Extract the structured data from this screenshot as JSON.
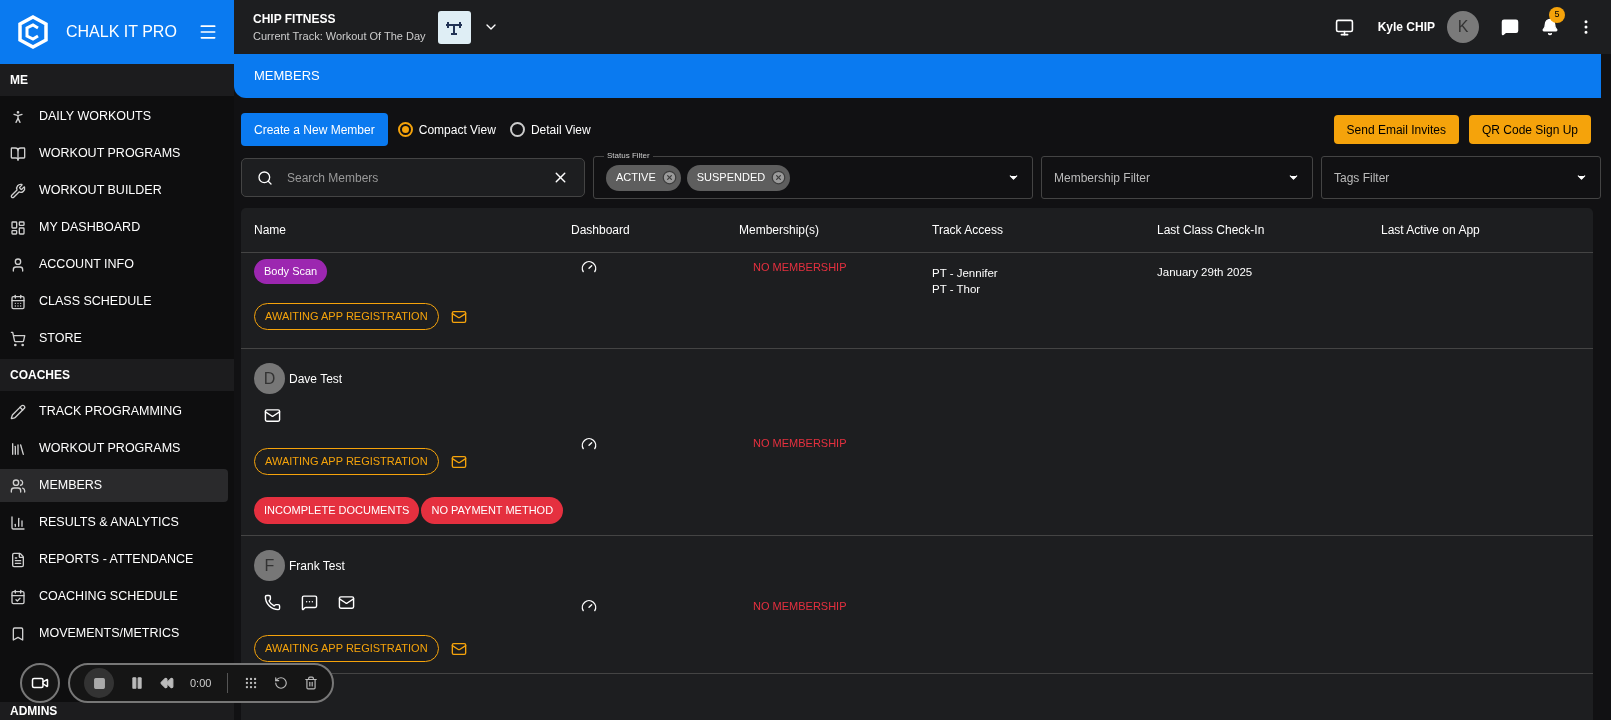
{
  "brand": {
    "name": "CHALK IT PRO"
  },
  "sidebar": {
    "sections": [
      {
        "title": "ME",
        "items": [
          {
            "label": "DAILY WORKOUTS",
            "selected": false
          },
          {
            "label": "WORKOUT PROGRAMS",
            "selected": false
          },
          {
            "label": "WORKOUT BUILDER",
            "selected": false
          },
          {
            "label": "MY DASHBOARD",
            "selected": false
          },
          {
            "label": "ACCOUNT INFO",
            "selected": false
          },
          {
            "label": "CLASS SCHEDULE",
            "selected": false
          },
          {
            "label": "STORE",
            "selected": false
          }
        ]
      },
      {
        "title": "COACHES",
        "items": [
          {
            "label": "TRACK PROGRAMMING",
            "selected": false
          },
          {
            "label": "WORKOUT PROGRAMS",
            "selected": false
          },
          {
            "label": "MEMBERS",
            "selected": true
          },
          {
            "label": "RESULTS & ANALYTICS",
            "selected": false
          },
          {
            "label": "REPORTS - ATTENDANCE",
            "selected": false
          },
          {
            "label": "COACHING SCHEDULE",
            "selected": false
          },
          {
            "label": "MOVEMENTS/METRICS",
            "selected": false
          }
        ]
      },
      {
        "title": "ADMINS"
      }
    ]
  },
  "topbar": {
    "gym": "CHIP FITNESS",
    "track": "Current Track: Workout Of The Day",
    "user": "Kyle CHIP",
    "avatar": "K",
    "notifications": "5"
  },
  "page_title": "MEMBERS",
  "create_button": "Create a New Member",
  "views": [
    {
      "label": "Compact View",
      "selected": true
    },
    {
      "label": "Detail View",
      "selected": false
    }
  ],
  "actions": [
    "Send Email Invites",
    "QR Code Sign Up"
  ],
  "search": {
    "placeholder": "Search Members"
  },
  "status_filter": {
    "label": "Status Filter",
    "chips": [
      "ACTIVE",
      "SUSPENDED"
    ]
  },
  "membership_filter": {
    "placeholder": "Membership Filter"
  },
  "tags_filter": {
    "placeholder": "Tags Filter"
  },
  "table": {
    "columns": [
      "Name",
      "Dashboard",
      "Membership(s)",
      "Track Access",
      "Last Class Check-In",
      "Last Active on App"
    ],
    "rows": [
      {
        "tags": [
          {
            "label": "Body Scan",
            "color": "#9c27b0"
          }
        ],
        "status": "AWAITING APP REGISTRATION",
        "alerts": [],
        "membership": "NO MEMBERSHIP",
        "track_access": [
          "PT - Jennifer",
          "PT - Thor"
        ],
        "last_checkin": "January 29th 2025",
        "contacts": []
      },
      {
        "avatar": "D",
        "name": "Dave Test",
        "contacts": [
          {
            "kind": "email"
          }
        ],
        "status": "AWAITING APP REGISTRATION",
        "alerts": [
          "INCOMPLETE DOCUMENTS",
          "NO PAYMENT METHOD"
        ],
        "membership": "NO MEMBERSHIP",
        "track_access": [],
        "tags": []
      },
      {
        "avatar": "F",
        "name": "Frank Test",
        "contacts": [
          {
            "kind": "phone"
          },
          {
            "kind": "sms"
          },
          {
            "kind": "email"
          }
        ],
        "status": "AWAITING APP REGISTRATION",
        "alerts": [],
        "membership": "NO MEMBERSHIP",
        "track_access": [],
        "tags": []
      }
    ]
  },
  "recorder": {
    "time": "0:00"
  }
}
